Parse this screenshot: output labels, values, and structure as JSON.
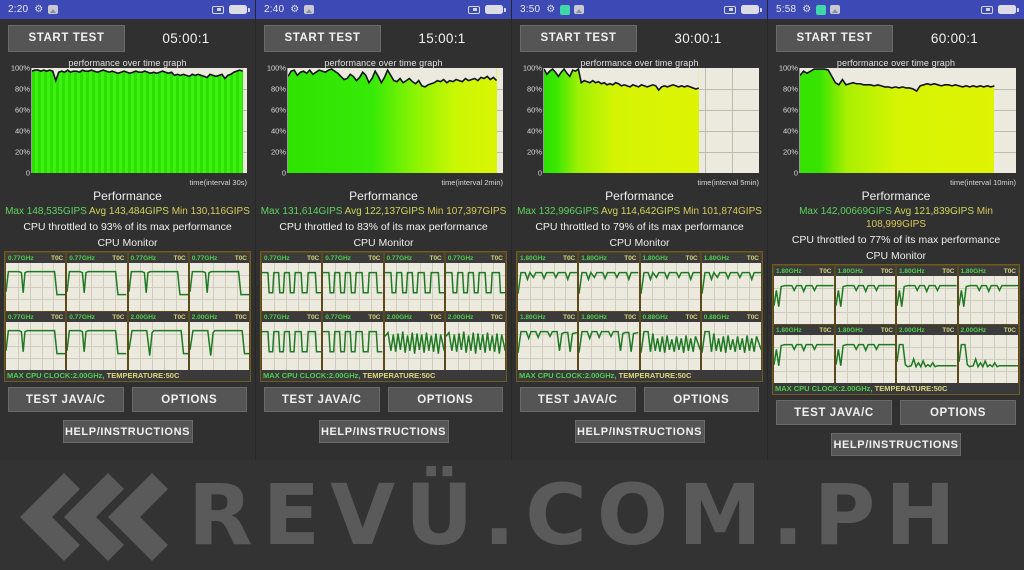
{
  "watermark": {
    "text": "REVÜ.COM.PH",
    "chevron_icon": "triple-chevron-left-icon",
    "color": "#5a5a5a"
  },
  "colors": {
    "statusbar": "#3d4ab5",
    "background": "#303030",
    "button": "#555555",
    "plot_bg": "#eceadf",
    "green": "#33dd11",
    "yellow_green": "#d8ee0a"
  },
  "chart_data": [
    {
      "type": "area",
      "title": "performance over time graph",
      "xlabel": "time(interval 30s)",
      "ylabel": "",
      "ylim": [
        0,
        100
      ],
      "yticks": [
        "0",
        "20%",
        "40%",
        "60%",
        "80%",
        "100%"
      ],
      "grid": true,
      "series_name": "performance %",
      "fill_fraction": 0.98,
      "values": [
        97,
        98,
        98,
        97,
        98,
        97,
        98,
        97,
        88,
        96,
        97,
        96,
        98,
        96,
        97,
        97,
        96,
        98,
        97,
        97,
        98,
        97,
        96,
        97,
        98,
        97,
        96,
        97,
        96,
        95,
        96,
        97,
        96,
        95,
        96,
        97,
        96,
        96,
        97,
        96,
        95,
        96,
        95,
        96,
        97,
        96,
        95,
        96,
        93,
        94,
        93,
        94,
        93,
        92,
        94,
        93,
        94,
        93,
        92,
        91,
        94,
        93,
        92,
        93,
        94,
        90,
        93,
        94,
        96,
        97,
        98,
        97
      ]
    },
    {
      "type": "area",
      "title": "performance over time graph",
      "xlabel": "time(interval 2min)",
      "ylabel": "",
      "ylim": [
        0,
        100
      ],
      "yticks": [
        "0",
        "20%",
        "40%",
        "60%",
        "80%",
        "100%"
      ],
      "grid": true,
      "series_name": "performance %",
      "fill_fraction": 0.97,
      "values": [
        92,
        97,
        98,
        93,
        96,
        97,
        95,
        98,
        94,
        96,
        98,
        97,
        96,
        98,
        99,
        97,
        95,
        92,
        89,
        90,
        94,
        92,
        88,
        91,
        96,
        93,
        86,
        90,
        97,
        92,
        86,
        91,
        98,
        93,
        88,
        87,
        90,
        86,
        88,
        90,
        87,
        85,
        88,
        83,
        82,
        84,
        85,
        86,
        88,
        87,
        89,
        86,
        88,
        87,
        89,
        88,
        87,
        90,
        88,
        89,
        90,
        88,
        91,
        90,
        92,
        89,
        91,
        88
      ]
    },
    {
      "type": "area",
      "title": "performance over time graph",
      "xlabel": "time(interval 5min)",
      "ylabel": "",
      "ylim": [
        0,
        100
      ],
      "yticks": [
        "0",
        "20%",
        "40%",
        "60%",
        "80%",
        "100%"
      ],
      "grid": true,
      "series_name": "performance %",
      "fill_fraction": 0.72,
      "values": [
        99,
        94,
        97,
        99,
        96,
        92,
        96,
        99,
        95,
        92,
        98,
        97,
        99,
        86,
        88,
        87,
        86,
        88,
        86,
        87,
        85,
        86,
        84,
        85,
        84,
        86,
        85,
        83,
        84,
        83,
        82,
        84,
        83,
        82,
        84,
        83,
        82,
        83,
        84,
        83,
        79,
        82,
        83,
        82,
        83,
        84,
        83,
        82,
        83,
        82,
        83,
        82,
        81,
        80,
        81
      ]
    },
    {
      "type": "area",
      "title": "performance over time graph",
      "xlabel": "time(interval 10min)",
      "ylabel": "",
      "ylim": [
        0,
        100
      ],
      "yticks": [
        "0",
        "20%",
        "40%",
        "60%",
        "80%",
        "100%"
      ],
      "grid": true,
      "series_name": "performance %",
      "fill_fraction": 0.9,
      "values": [
        93,
        97,
        95,
        97,
        99,
        99,
        99,
        99,
        98,
        92,
        86,
        84,
        89,
        84,
        85,
        86,
        85,
        85,
        84,
        84,
        84,
        83,
        84,
        83,
        82,
        82,
        81,
        82,
        81,
        82,
        81,
        81,
        80,
        78,
        83,
        84,
        85,
        84,
        85,
        84,
        83,
        84,
        84,
        83,
        84,
        83,
        82,
        83,
        82,
        83,
        82,
        83,
        82,
        83,
        82,
        83
      ]
    }
  ],
  "panels": [
    {
      "statusbar": {
        "time": "2:20",
        "icons": [
          "gear-icon",
          "photo-icon"
        ],
        "right_icons": [
          "chip-icon",
          "battery-icon"
        ]
      },
      "start_label": "START TEST",
      "timer": "05:00:1",
      "chart_title": "performance over time graph",
      "chart_time_label": "time(interval 30s)",
      "perf_title": "Performance",
      "perf_max": "Max 148,535GIPS",
      "perf_avg": "Avg 143,484GIPS",
      "perf_min": "Min 130,116GIPS",
      "perf_throttle": "CPU throttled to 93% of its max performance",
      "cpu_title": "CPU Monitor",
      "cores": [
        {
          "freq": "0.77GHz",
          "temp": "T0C"
        },
        {
          "freq": "0.77GHz",
          "temp": "T0C"
        },
        {
          "freq": "0.77GHz",
          "temp": "T0C"
        },
        {
          "freq": "0.77GHz",
          "temp": "T0C"
        },
        {
          "freq": "0.77GHz",
          "temp": "T0C"
        },
        {
          "freq": "0.77GHz",
          "temp": "T0C"
        },
        {
          "freq": "2.00GHz",
          "temp": "T0C"
        },
        {
          "freq": "2.00GHz",
          "temp": "T0C"
        }
      ],
      "cpu_status_clock": "MAX CPU CLOCK:2.00GHz,",
      "cpu_status_temp": "TEMPERATURE:50C",
      "test_label": "TEST JAVA/C",
      "options_label": "OPTIONS",
      "help_label": "HELP/INSTRUCTIONS"
    },
    {
      "statusbar": {
        "time": "2:40",
        "icons": [
          "gear-icon",
          "photo-icon"
        ],
        "right_icons": [
          "chip-icon",
          "battery-icon"
        ]
      },
      "start_label": "START TEST",
      "timer": "15:00:1",
      "chart_title": "performance over time graph",
      "chart_time_label": "time(interval 2min)",
      "perf_title": "Performance",
      "perf_max": "Max 131,614GIPS",
      "perf_avg": "Avg 122,137GIPS",
      "perf_min": "Min 107,397GIPS",
      "perf_throttle": "CPU throttled to 83% of its max performance",
      "cpu_title": "CPU Monitor",
      "cores": [
        {
          "freq": "0.77GHz",
          "temp": "T0C"
        },
        {
          "freq": "0.77GHz",
          "temp": "T0C"
        },
        {
          "freq": "0.77GHz",
          "temp": "T0C"
        },
        {
          "freq": "0.77GHz",
          "temp": "T0C"
        },
        {
          "freq": "0.77GHz",
          "temp": "T0C"
        },
        {
          "freq": "0.77GHz",
          "temp": "T0C"
        },
        {
          "freq": "2.00GHz",
          "temp": "T0C"
        },
        {
          "freq": "2.00GHz",
          "temp": "T0C"
        }
      ],
      "cpu_status_clock": "MAX CPU CLOCK:2.00GHz,",
      "cpu_status_temp": "TEMPERATURE:50C",
      "test_label": "TEST JAVA/C",
      "options_label": "OPTIONS",
      "help_label": "HELP/INSTRUCTIONS"
    },
    {
      "statusbar": {
        "time": "3:50",
        "icons": [
          "gear-icon",
          "green-app-icon",
          "photo-icon"
        ],
        "right_icons": [
          "chip-icon",
          "battery-icon"
        ]
      },
      "start_label": "START TEST",
      "timer": "30:00:1",
      "chart_title": "performance over time graph",
      "chart_time_label": "time(interval 5min)",
      "perf_title": "Performance",
      "perf_max": "Max 132,996GIPS",
      "perf_avg": "Avg 114,642GIPS",
      "perf_min": "Min 101,874GIPS",
      "perf_throttle": "CPU throttled to 79% of its max performance",
      "cpu_title": "CPU Monitor",
      "cores": [
        {
          "freq": "1.80GHz",
          "temp": "T0C"
        },
        {
          "freq": "1.80GHz",
          "temp": "T0C"
        },
        {
          "freq": "1.80GHz",
          "temp": "T0C"
        },
        {
          "freq": "1.80GHz",
          "temp": "T0C"
        },
        {
          "freq": "1.80GHz",
          "temp": "T0C"
        },
        {
          "freq": "1.80GHz",
          "temp": "T0C"
        },
        {
          "freq": "0.88GHz",
          "temp": "T0C"
        },
        {
          "freq": "0.88GHz",
          "temp": "T0C"
        }
      ],
      "cpu_status_clock": "MAX CPU CLOCK:2.00GHz,",
      "cpu_status_temp": "TEMPERATURE:50C",
      "test_label": "TEST JAVA/C",
      "options_label": "OPTIONS",
      "help_label": "HELP/INSTRUCTIONS"
    },
    {
      "statusbar": {
        "time": "5:58",
        "icons": [
          "gear-icon",
          "green-app-icon",
          "photo-icon"
        ],
        "right_icons": [
          "chip-icon",
          "battery-icon"
        ]
      },
      "start_label": "START TEST",
      "timer": "60:00:1",
      "chart_title": "performance over time graph",
      "chart_time_label": "time(interval 10min)",
      "perf_title": "Performance",
      "perf_max": "Max 142,00669GIPS",
      "perf_avg": "Avg 121,839GIPS",
      "perf_min": "Min 108,999GIPS",
      "perf_throttle": "CPU throttled to 77% of its max performance",
      "cpu_title": "CPU Monitor",
      "cores": [
        {
          "freq": "1.80GHz",
          "temp": "T0C"
        },
        {
          "freq": "1.80GHz",
          "temp": "T0C"
        },
        {
          "freq": "1.80GHz",
          "temp": "T0C"
        },
        {
          "freq": "1.80GHz",
          "temp": "T0C"
        },
        {
          "freq": "1.80GHz",
          "temp": "T0C"
        },
        {
          "freq": "1.80GHz",
          "temp": "T0C"
        },
        {
          "freq": "2.00GHz",
          "temp": "T0C"
        },
        {
          "freq": "2.00GHz",
          "temp": "T0C"
        }
      ],
      "cpu_status_clock": "MAX CPU CLOCK:2.00GHz,",
      "cpu_status_temp": "TEMPERATURE:50C",
      "test_label": "TEST JAVA/C",
      "options_label": "OPTIONS",
      "help_label": "HELP/INSTRUCTIONS"
    }
  ],
  "core_traces": [
    [
      [
        0,
        72
      ],
      [
        6,
        72
      ],
      [
        8,
        16
      ],
      [
        14,
        16
      ],
      [
        16,
        16
      ],
      [
        20,
        16
      ],
      [
        22,
        62
      ],
      [
        26,
        62
      ],
      [
        28,
        16
      ],
      [
        60,
        16
      ],
      [
        62,
        16
      ],
      [
        78,
        16
      ],
      [
        80,
        78
      ],
      [
        92,
        78
      ],
      [
        100,
        78
      ]
    ],
    [
      [
        0,
        72
      ],
      [
        6,
        72
      ],
      [
        8,
        16
      ],
      [
        18,
        16
      ],
      [
        22,
        62
      ],
      [
        26,
        62
      ],
      [
        28,
        16
      ],
      [
        62,
        16
      ],
      [
        80,
        16
      ],
      [
        82,
        78
      ],
      [
        92,
        78
      ],
      [
        100,
        78
      ]
    ],
    [
      [
        0,
        72
      ],
      [
        6,
        72
      ],
      [
        8,
        16
      ],
      [
        18,
        16
      ],
      [
        22,
        62
      ],
      [
        26,
        62
      ],
      [
        28,
        16
      ],
      [
        64,
        16
      ],
      [
        82,
        16
      ],
      [
        84,
        78
      ],
      [
        92,
        78
      ],
      [
        100,
        78
      ]
    ],
    [
      [
        0,
        72
      ],
      [
        8,
        72
      ],
      [
        10,
        16
      ],
      [
        20,
        16
      ],
      [
        24,
        62
      ],
      [
        28,
        62
      ],
      [
        30,
        16
      ],
      [
        66,
        16
      ],
      [
        84,
        16
      ],
      [
        86,
        78
      ],
      [
        94,
        78
      ],
      [
        100,
        78
      ]
    ],
    [
      [
        0,
        72
      ],
      [
        6,
        72
      ],
      [
        8,
        16
      ],
      [
        18,
        16
      ],
      [
        22,
        62
      ],
      [
        26,
        62
      ],
      [
        28,
        16
      ],
      [
        66,
        16
      ],
      [
        82,
        16
      ],
      [
        84,
        78
      ],
      [
        92,
        78
      ],
      [
        100,
        78
      ]
    ],
    [
      [
        0,
        72
      ],
      [
        6,
        72
      ],
      [
        8,
        16
      ],
      [
        18,
        16
      ],
      [
        22,
        58
      ],
      [
        24,
        30
      ],
      [
        26,
        62
      ],
      [
        28,
        16
      ],
      [
        66,
        16
      ],
      [
        84,
        16
      ],
      [
        86,
        78
      ],
      [
        94,
        78
      ],
      [
        100,
        78
      ]
    ],
    [
      [
        0,
        70
      ],
      [
        10,
        70
      ],
      [
        12,
        16
      ],
      [
        26,
        16
      ],
      [
        30,
        68
      ],
      [
        33,
        30
      ],
      [
        36,
        16
      ],
      [
        62,
        16
      ],
      [
        66,
        16
      ],
      [
        70,
        16
      ],
      [
        74,
        16
      ],
      [
        78,
        16
      ],
      [
        100,
        16
      ]
    ],
    [
      [
        0,
        70
      ],
      [
        12,
        70
      ],
      [
        14,
        16
      ],
      [
        28,
        16
      ],
      [
        32,
        68
      ],
      [
        35,
        30
      ],
      [
        38,
        16
      ],
      [
        66,
        16
      ],
      [
        70,
        16
      ],
      [
        76,
        16
      ],
      [
        100,
        16
      ]
    ]
  ]
}
